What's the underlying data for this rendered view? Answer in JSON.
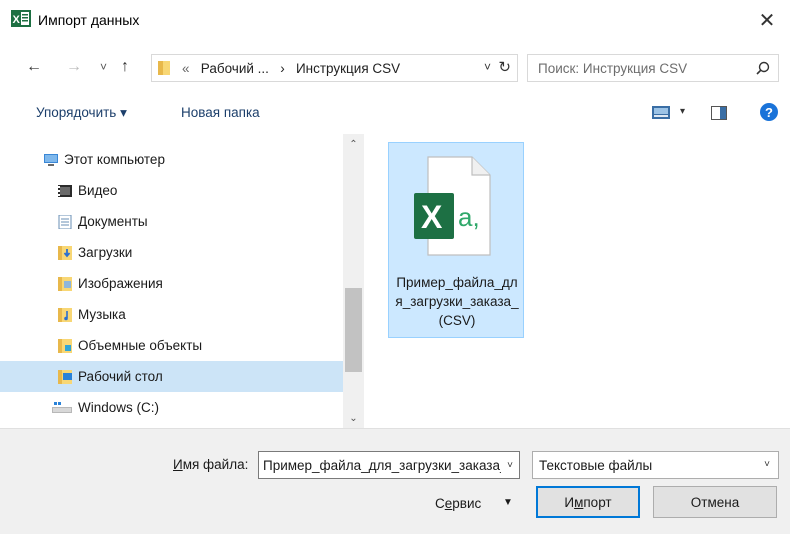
{
  "window": {
    "title": "Импорт данных",
    "close_glyph": "✕",
    "app_icon": "excel-icon",
    "accent_color": "#0078d7",
    "selection_color": "#cce4f7"
  },
  "navigation": {
    "back_glyph": "←",
    "forward_glyph": "→",
    "recent_glyph": "˅",
    "up_glyph": "↑",
    "breadcrumb_overflow": "«",
    "breadcrumb_parent": "Рабочий ...",
    "breadcrumb_sep": "›",
    "breadcrumb_current": "Инструкция CSV",
    "address_dropdown_glyph": "˅",
    "refresh_glyph": "↻",
    "search_placeholder": "Поиск: Инструкция CSV"
  },
  "toolbar": {
    "organize_label": "Упорядочить ▾",
    "new_folder_label": "Новая папка",
    "view_dropdown_glyph": "▾",
    "help_glyph": "?"
  },
  "tree": {
    "items": [
      {
        "label": "Этот компьютер",
        "icon": "computer-icon"
      },
      {
        "label": "Видео",
        "icon": "video-folder-icon"
      },
      {
        "label": "Документы",
        "icon": "documents-folder-icon"
      },
      {
        "label": "Загрузки",
        "icon": "downloads-folder-icon"
      },
      {
        "label": "Изображения",
        "icon": "pictures-folder-icon"
      },
      {
        "label": "Музыка",
        "icon": "music-folder-icon"
      },
      {
        "label": "Объемные объекты",
        "icon": "3d-objects-folder-icon"
      },
      {
        "label": "Рабочий стол",
        "icon": "desktop-folder-icon",
        "selected": true
      },
      {
        "label": "Windows (C:)",
        "icon": "drive-icon"
      }
    ]
  },
  "scrollbar": {
    "up_glyph": "⌃",
    "down_glyph": "⌄"
  },
  "files": [
    {
      "name": "Пример_файла_для_загрузки_заказа_(CSV)",
      "icon": "excel-csv-file-icon",
      "selected": true
    }
  ],
  "footer": {
    "filename_label_prefix": "И",
    "filename_label_rest": "мя файла:",
    "filename_value": "Пример_файла_для_загрузки_заказа_(CSV)",
    "filename_dropdown_glyph": "˅",
    "filetype_value": "Текстовые файлы",
    "filetype_dropdown_glyph": "˅",
    "tools_label_prefix": "С",
    "tools_label_underlined": "е",
    "tools_label_rest": "рвис",
    "tools_arrow_glyph": "▼",
    "import_label_prefix": "И",
    "import_label_underlined": "м",
    "import_label_rest": "порт",
    "cancel_label": "Отмена"
  }
}
